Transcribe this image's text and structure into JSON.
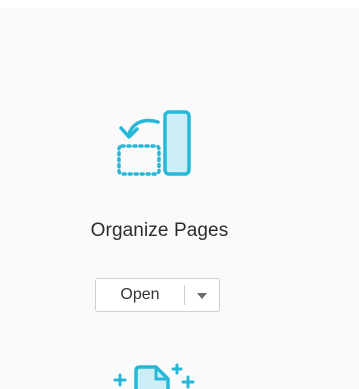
{
  "tool": {
    "label": "Organize Pages",
    "icon": "organize-pages-icon",
    "open_label": "Open",
    "dropdown_icon": "caret-down-icon",
    "accent_color": "#26b8d6",
    "accent_fill": "#cdeef6"
  },
  "next_tool": {
    "icon": "enhance-scans-icon"
  }
}
